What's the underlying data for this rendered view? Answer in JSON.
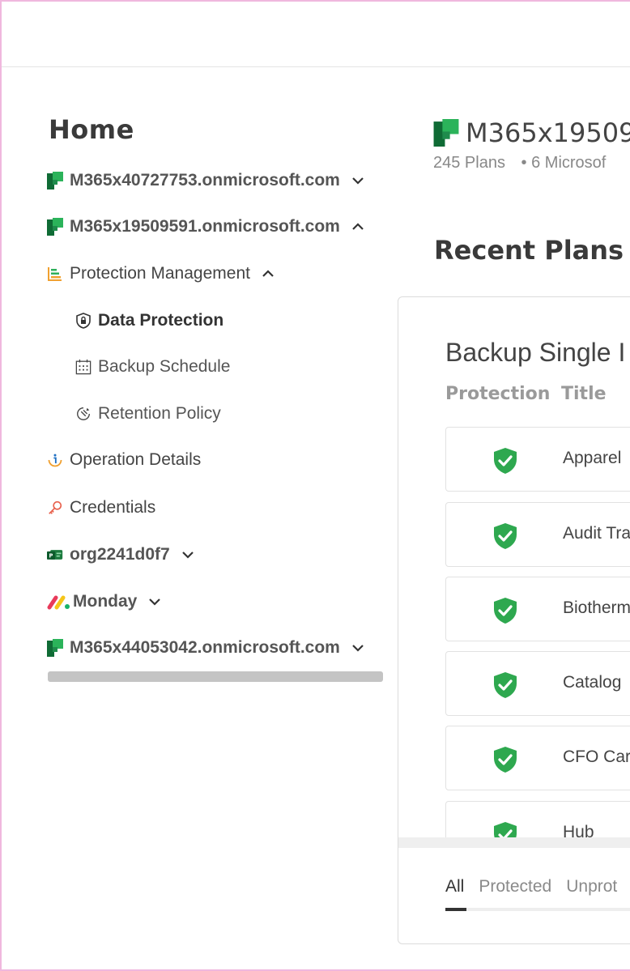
{
  "sidebar": {
    "home_title": "Home",
    "items": [
      {
        "label": "M365x40727753.onmicrosoft.com",
        "icon": "microsoft-planner-icon",
        "chevron": "down"
      },
      {
        "label": "M365x19509591.onmicrosoft.com",
        "icon": "microsoft-planner-icon",
        "chevron": "up"
      },
      {
        "label": "Protection Management",
        "icon": "bar-chart-icon",
        "chevron": "up"
      },
      {
        "label": "Data Protection",
        "icon": "shield-lock-icon",
        "active": true
      },
      {
        "label": "Backup Schedule",
        "icon": "calendar-icon"
      },
      {
        "label": "Retention Policy",
        "icon": "retention-icon"
      },
      {
        "label": "Operation Details",
        "icon": "info-icon"
      },
      {
        "label": "Credentials",
        "icon": "key-icon"
      },
      {
        "label": "org2241d0f7",
        "icon": "project-icon",
        "chevron": "down"
      },
      {
        "label": "Monday",
        "icon": "monday-logo",
        "chevron": "down"
      },
      {
        "label": "M365x44053042.onmicrosoft.com",
        "icon": "microsoft-planner-icon",
        "chevron": "down"
      }
    ]
  },
  "main": {
    "tenant_name": "M365x19509",
    "tenant_plans": "245 Plans",
    "tenant_sep": "•",
    "tenant_extra": "6 Microsof",
    "recent_title": "Recent Plans",
    "card": {
      "title": "Backup Single I",
      "col_protection": "Protection",
      "col_title": "Title",
      "rows": [
        {
          "title": "Apparel",
          "status": "protected"
        },
        {
          "title": "Audit Tra",
          "status": "protected"
        },
        {
          "title": "Biotherm",
          "status": "protected"
        },
        {
          "title": "Catalog",
          "status": "protected"
        },
        {
          "title": "CFO Car",
          "status": "protected"
        },
        {
          "title": "Hub",
          "status": "protected"
        }
      ],
      "tabs": [
        "All",
        "Protected",
        "Unprot"
      ]
    }
  },
  "colors": {
    "planner_green": "#1f8b4c",
    "shield_green": "#2ea84f",
    "frame_pink": "#f0b8de"
  }
}
